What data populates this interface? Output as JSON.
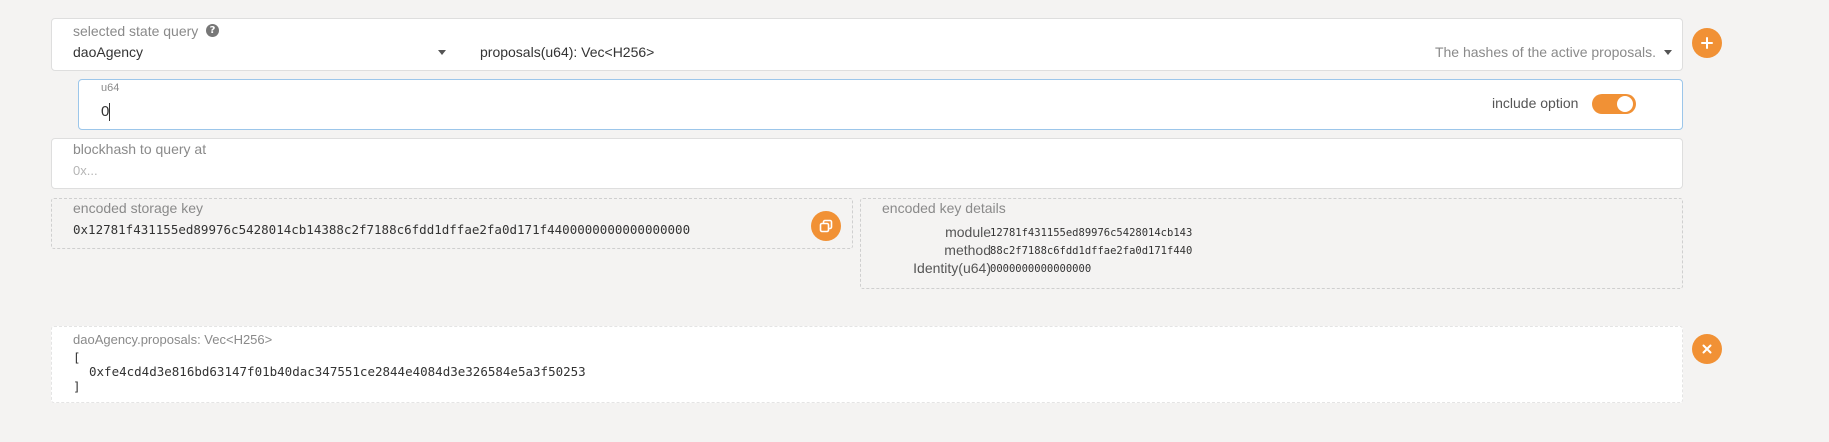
{
  "query": {
    "label": "selected state query",
    "help_icon": "?",
    "module_value": "daoAgency",
    "method_value": "proposals(u64): Vec<H256>",
    "method_doc": "The hashes of the active proposals."
  },
  "param": {
    "type_label": "u64",
    "value": "0",
    "include_option_label": "include option",
    "include_option_on": true
  },
  "blockhash": {
    "label": "blockhash to query at",
    "placeholder": "0x..."
  },
  "encoded_key": {
    "label": "encoded storage key",
    "value": "0x12781f431155ed89976c5428014cb14388c2f7188c6fdd1dffae2fa0d171f4400000000000000000"
  },
  "key_details": {
    "label": "encoded key details",
    "rows": [
      {
        "key": "module",
        "value": "12781f431155ed89976c5428014cb143"
      },
      {
        "key": "method",
        "value": "88c2f7188c6fdd1dffae2fa0d171f440"
      },
      {
        "key": "Identity(u64)",
        "value": "0000000000000000"
      }
    ]
  },
  "result": {
    "label": "daoAgency.proposals: Vec<H256>",
    "line_open": "[",
    "line_item": "0xfe4cd4d3e816bd63147f01b40dac347551ce2844e4084d3e326584e5a3f50253",
    "line_close": "]"
  },
  "colors": {
    "accent": "#f19135",
    "background": "#f4f3f2",
    "panel": "#ffffff"
  },
  "icons": {
    "add": "plus-icon",
    "remove": "close-icon",
    "copy": "copy-icon"
  }
}
